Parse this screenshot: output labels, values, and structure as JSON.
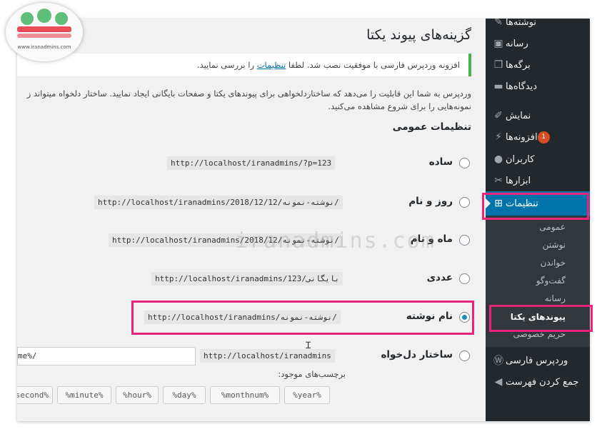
{
  "logo": {
    "text": "www.iranadmins.com"
  },
  "watermark": "iranadmins.com",
  "sidebar": {
    "items": [
      {
        "label": "نوشته‌ها",
        "icon": "pin-icon"
      },
      {
        "label": "رسانه",
        "icon": "media-icon"
      },
      {
        "label": "برگه‌ها",
        "icon": "pages-icon"
      },
      {
        "label": "دیدگاه‌ها",
        "icon": "comments-icon"
      },
      {
        "label": "نمایش",
        "icon": "appearance-icon"
      },
      {
        "label": "افزونه‌ها",
        "icon": "plugins-icon",
        "badge": "1"
      },
      {
        "label": "کاربران",
        "icon": "users-icon"
      },
      {
        "label": "ابزارها",
        "icon": "tools-icon"
      },
      {
        "label": "تنظیمات",
        "icon": "settings-icon",
        "active": true
      },
      {
        "label": "وردپرس فارسی",
        "icon": "wordpress-icon"
      },
      {
        "label": "جمع کردن فهرست",
        "icon": "collapse-icon"
      }
    ],
    "submenu": [
      "عمومی",
      "نوشتن",
      "خواندن",
      "گفت‌وگو",
      "رسانه",
      "پیوندهای یکتا",
      "حریم خصوصی"
    ]
  },
  "page": {
    "title": "گزینه‌های پیوند یکتا",
    "notice": {
      "before": "افزونه وردپرس فارسی با موفقیت نصب شد. لطفا",
      "link": "تنظیمات",
      "after": "را بررسی نمایید."
    },
    "intro_line1": "وردپرس به شما این قابلیت را می‌دهد که ساختاردلخواهی برای پیوندهای یکتا و صفحات بایگانی ایجاد نمایید. ساختار دلخواه میتواند ز",
    "intro_line2": "نمونه‌هایی را برای شروع مشاهده می‌کنید.",
    "section_title": "تنظیمات عمومی"
  },
  "options": [
    {
      "label": "ساده",
      "url": "http://localhost/iranadmins/?p=123",
      "checked": false
    },
    {
      "label": "روز و نام",
      "url": "http://localhost/iranadmins/2018/12/12/نوشته-نمونه/",
      "checked": false
    },
    {
      "label": "ماه و نام",
      "url": "http://localhost/iranadmins/2018/12/نوشته-نمونه/",
      "checked": false
    },
    {
      "label": "عددی",
      "url": "http://localhost/iranadmins/بایگانی/123",
      "checked": false
    },
    {
      "label": "نام نوشته",
      "url": "http://localhost/iranadmins/نوشته-نمونه/",
      "checked": true
    },
    {
      "label": "ساختار دل‌خواه",
      "url": "http://localhost/iranadmins",
      "checked": false
    }
  ],
  "custom": {
    "value": "me%/",
    "tags_label": "برچسب‌های موجود:",
    "tags": [
      "%year%",
      "%monthnum%",
      "%day%",
      "%hour%",
      "%minute%",
      "%second%"
    ]
  },
  "colors": {
    "sidebar": "#23282d",
    "active": "#0073aa",
    "highlight": "#e8247b"
  }
}
